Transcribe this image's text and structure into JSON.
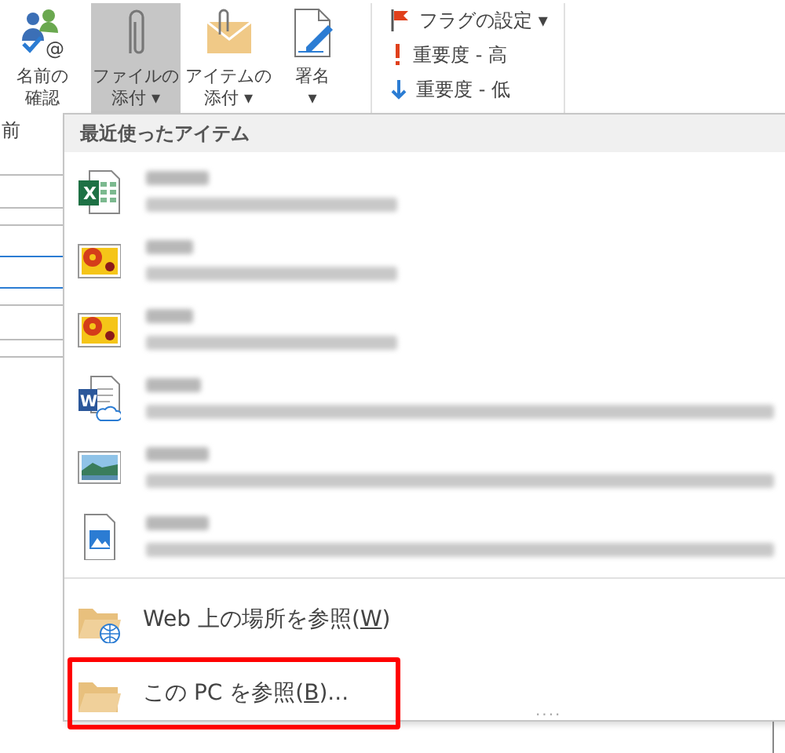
{
  "ribbon": {
    "large_buttons": [
      {
        "kind": "names",
        "icon_glyph": "@",
        "lines": [
          "名前の",
          "確認"
        ],
        "selected": false
      },
      {
        "kind": "clip",
        "lines": [
          "ファイルの",
          "添付"
        ],
        "selected": true,
        "caret": "▾"
      },
      {
        "kind": "envelope",
        "lines": [
          "アイテムの",
          "添付"
        ],
        "selected": false,
        "caret": "▾"
      },
      {
        "kind": "signature",
        "lines": [
          "署名"
        ],
        "selected": false,
        "caret": "▾"
      }
    ],
    "small_buttons": [
      {
        "kind": "flag",
        "label": "フラグの設定",
        "caret": "▾"
      },
      {
        "kind": "high",
        "label": "重要度 - 高"
      },
      {
        "kind": "low",
        "label": "重要度 - 低"
      }
    ],
    "group_label": "前"
  },
  "menu": {
    "header": "最近使ったアイテム",
    "recent_items": [
      {
        "kind": "excel",
        "icon_glyph": "X"
      },
      {
        "kind": "photo"
      },
      {
        "kind": "photo"
      },
      {
        "kind": "word-cloud",
        "icon_glyph": "W"
      },
      {
        "kind": "landscape"
      },
      {
        "kind": "image-file"
      }
    ],
    "actions": [
      {
        "kind": "web",
        "text_before": "Web 上の場所を参照(",
        "access_key": "W",
        "text_after": ")",
        "highlighted": false
      },
      {
        "kind": "folder",
        "text_before": "この PC を参照(",
        "access_key": "B",
        "text_after": ")...",
        "highlighted": true
      }
    ],
    "grip": "...."
  }
}
